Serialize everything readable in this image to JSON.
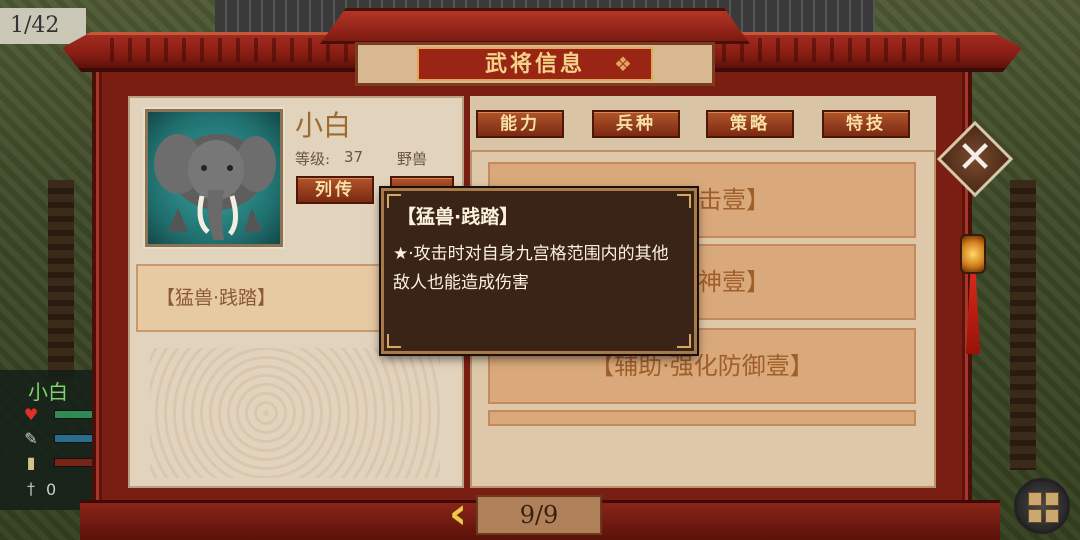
{
  "hud": {
    "turn_counter": "1/42"
  },
  "window": {
    "title": "武将信息"
  },
  "general": {
    "name": "小白",
    "level_label": "等级:",
    "level_value": "37",
    "race": "野兽",
    "bio_button": "列传",
    "skill_name": "【猛兽·践踏】"
  },
  "tabs": [
    {
      "label": "能力"
    },
    {
      "label": "兵种"
    },
    {
      "label": "策略"
    },
    {
      "label": "特技"
    }
  ],
  "skills_list": [
    {
      "label": "击壹】"
    },
    {
      "label": "神壹】"
    },
    {
      "label": "【辅助·强化防御壹】"
    }
  ],
  "tooltip": {
    "title": "【猛兽·践踏】",
    "description": "★·攻击时对自身九宫格范围内的其他敌人也能造成伤害"
  },
  "pager": {
    "page": "9/9"
  },
  "unit_panel": {
    "name": "小白",
    "kills": "0"
  },
  "colors": {
    "frame_red": "#7a1e14",
    "parchment": "#e2d3bd",
    "gold_text": "#f3d28a",
    "tooltip_bg": "#3a2418"
  }
}
